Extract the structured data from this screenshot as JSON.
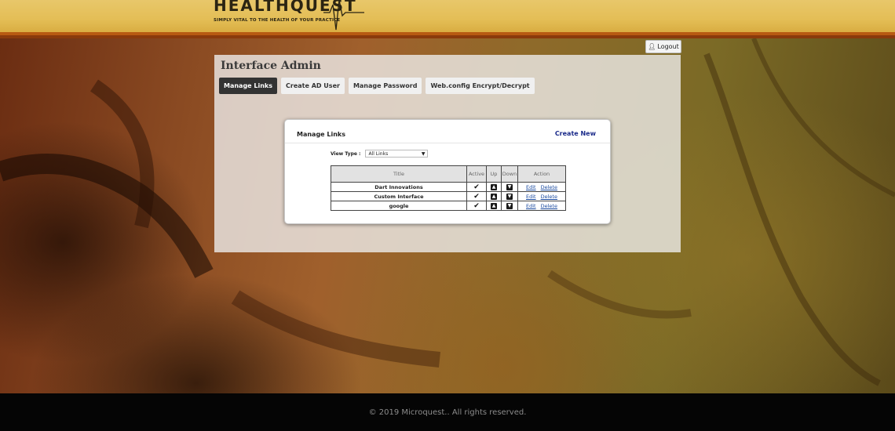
{
  "header": {
    "logo_text": "HEALTHQUEST",
    "tagline": "SIMPLY VITAL TO THE HEALTH OF YOUR PRACTICE"
  },
  "logout_label": "Logout",
  "panel": {
    "title": "Interface Admin",
    "tabs": [
      {
        "label": "Manage Links",
        "active": true
      },
      {
        "label": "Create AD User",
        "active": false
      },
      {
        "label": "Manage Password",
        "active": false
      },
      {
        "label": "Web.config Encrypt/Decrypt",
        "active": false
      }
    ]
  },
  "card": {
    "title": "Manage Links",
    "create_new": "Create New",
    "view_type_label": "View Type :",
    "view_type_value": "All Links",
    "table": {
      "headers": [
        "Title",
        "Active",
        "Up",
        "Down",
        "Action"
      ],
      "rows": [
        {
          "title": "Dart Innovations",
          "edit": "Edit",
          "delete": "Delete"
        },
        {
          "title": "Custom Interface",
          "edit": "Edit",
          "delete": "Delete"
        },
        {
          "title": "google",
          "edit": "Edit",
          "delete": "Delete"
        }
      ]
    }
  },
  "footer": {
    "copyright": "© 2019 Microquest.. All rights reserved."
  }
}
